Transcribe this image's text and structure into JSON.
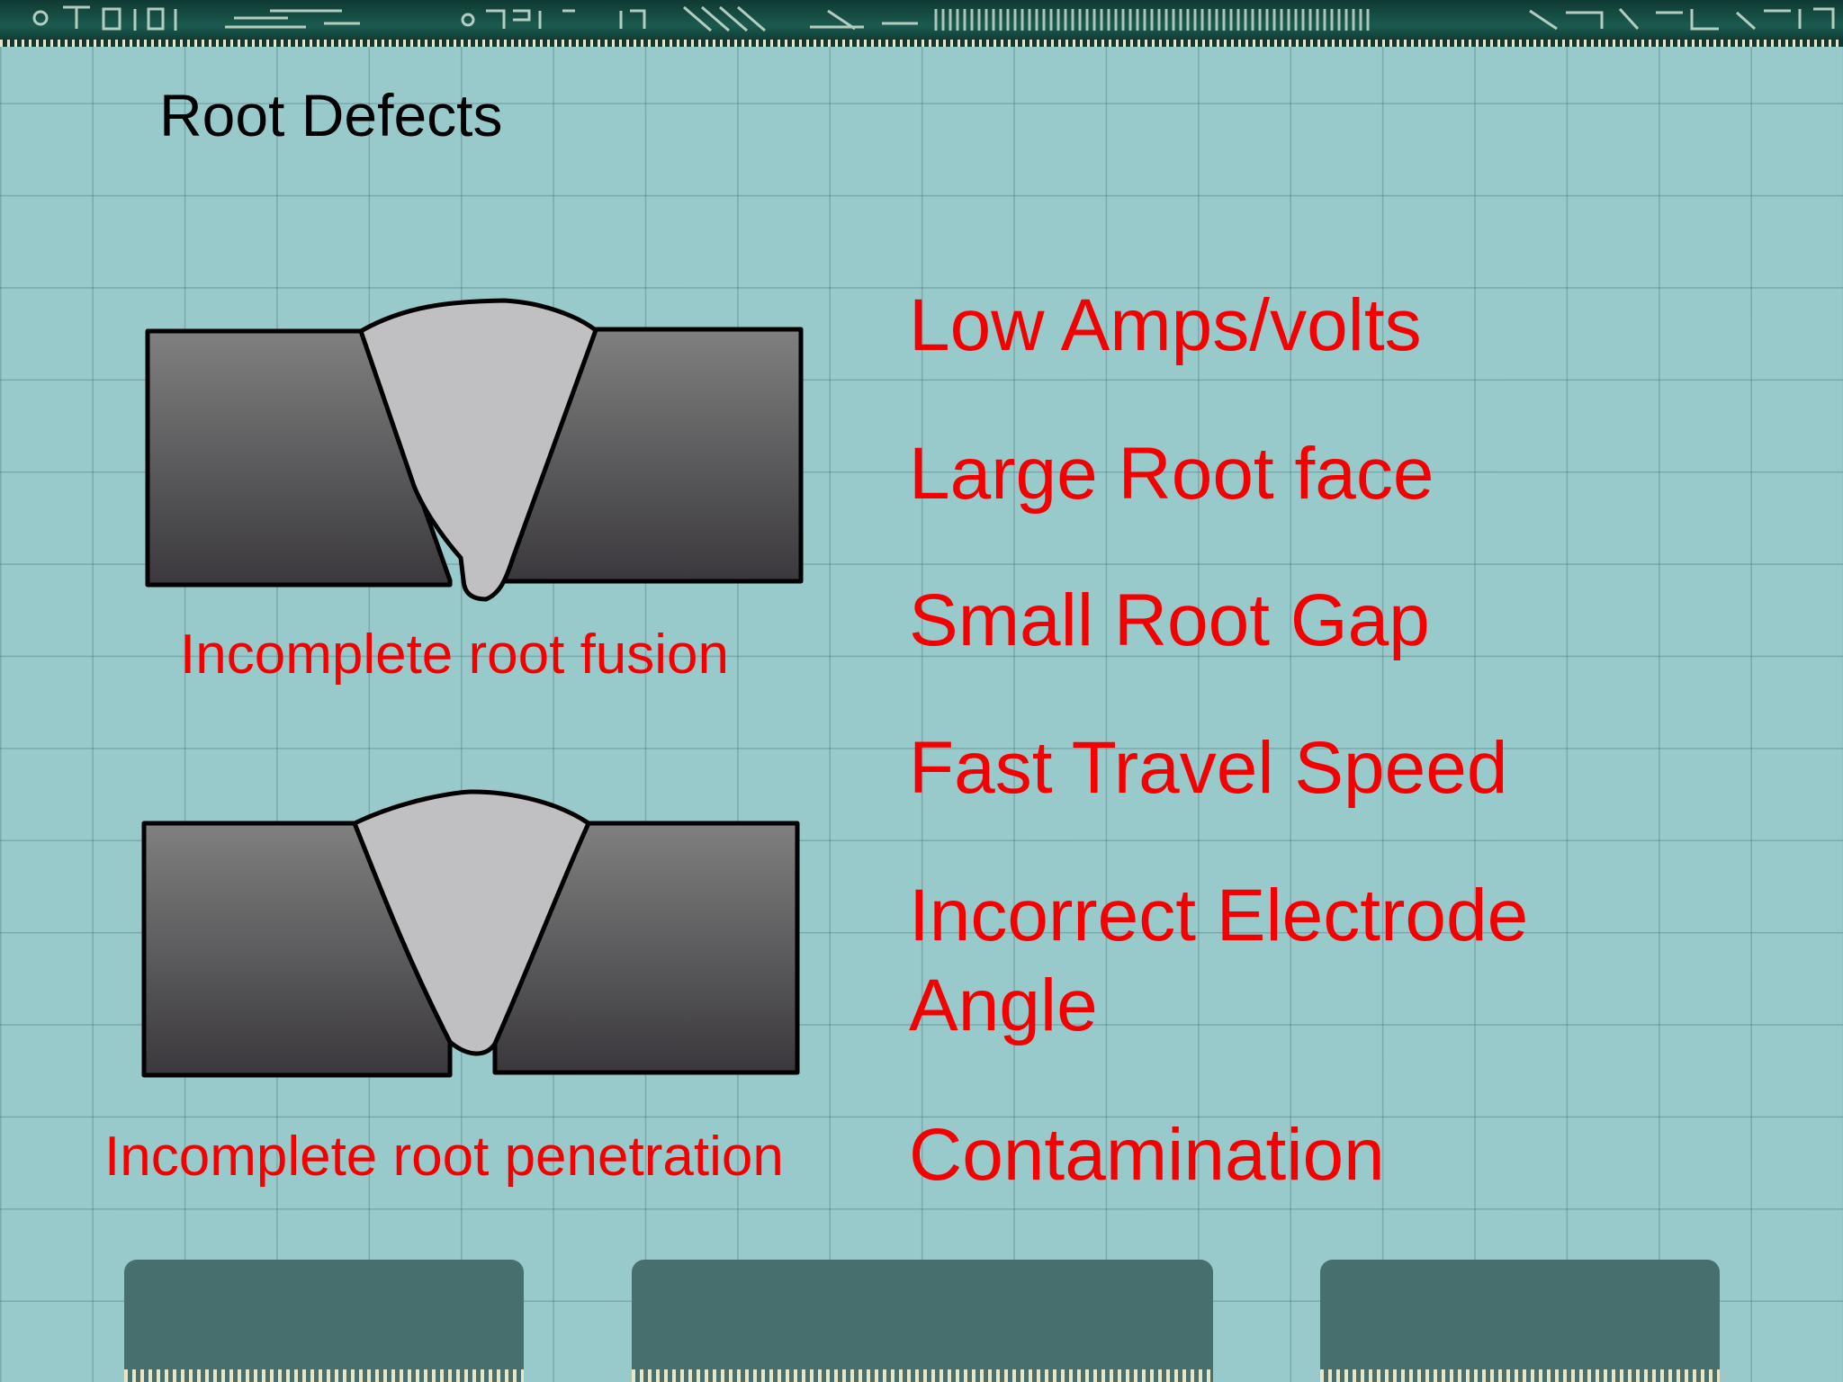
{
  "slide": {
    "title": "Root Defects",
    "diagrams": [
      {
        "caption": "Incomplete root fusion"
      },
      {
        "caption": "Incomplete root penetration"
      }
    ],
    "causes": [
      {
        "line1": "Low Amps/volts",
        "line2": ""
      },
      {
        "line1": "Large Root face",
        "line2": ""
      },
      {
        "line1": "Small Root Gap",
        "line2": ""
      },
      {
        "line1": "Fast Travel Speed",
        "line2": ""
      },
      {
        "line1": "Incorrect Electrode",
        "line2": "Angle"
      },
      {
        "line1": "Contamination",
        "line2": ""
      }
    ]
  },
  "colors": {
    "background": "#98c9cb",
    "text_accent": "#f40000",
    "plate_light": "#808080",
    "plate_dark": "#3a383c",
    "weld_metal": "#c0bfc1",
    "tab": "#476f6d"
  }
}
